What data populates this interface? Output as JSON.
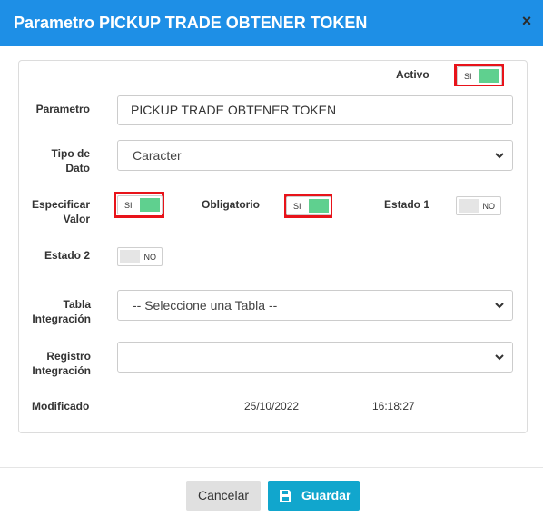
{
  "dialog": {
    "title": "Parametro PICKUP TRADE OBTENER TOKEN",
    "close_icon": "×"
  },
  "form": {
    "activo": {
      "label": "Activo",
      "toggle_text": "SI",
      "state": "on"
    },
    "parametro": {
      "label": "Parametro",
      "value": "PICKUP TRADE OBTENER TOKEN"
    },
    "tipo_dato": {
      "label_line1": "Tipo de",
      "label_line2": "Dato",
      "value": "Caracter"
    },
    "especificar_valor": {
      "label_line1": "Especificar",
      "label_line2": "Valor",
      "toggle_text": "SI",
      "state": "on"
    },
    "obligatorio": {
      "label": "Obligatorio",
      "toggle_text": "SI",
      "state": "on"
    },
    "estado1": {
      "label": "Estado 1",
      "toggle_text": "NO",
      "state": "off"
    },
    "estado2": {
      "label": "Estado 2",
      "toggle_text": "NO",
      "state": "off"
    },
    "tabla_integracion": {
      "label_line1": "Tabla",
      "label_line2": "Integración",
      "value": "-- Seleccione una Tabla --"
    },
    "registro_integracion": {
      "label_line1": "Registro",
      "label_line2": "Integración",
      "value": ""
    },
    "modificado": {
      "label": "Modificado",
      "date": "25/10/2022",
      "time": "16:18:27"
    }
  },
  "footer": {
    "cancel_label": "Cancelar",
    "save_label": "Guardar",
    "save_icon": "save-icon"
  },
  "colors": {
    "header": "#1e8fe6",
    "toggle_on": "#5fd08f",
    "highlight": "#e8131a",
    "save_button": "#11a6cd"
  }
}
